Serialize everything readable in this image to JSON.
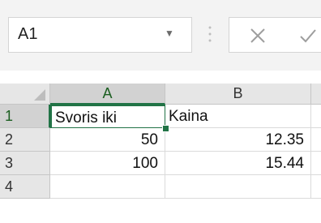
{
  "formula_bar": {
    "name_box": "A1",
    "fx_value": ""
  },
  "icons": {
    "name_box_dropdown": "chevron-down-icon",
    "separator": "vertical-dots-icon",
    "cancel": "close-icon",
    "enter": "checkmark-icon"
  },
  "columns": [
    "A",
    "B"
  ],
  "rows": [
    "1",
    "2",
    "3",
    "4"
  ],
  "cells": [
    [
      "Svoris iki",
      "Kaina"
    ],
    [
      "50",
      "12.35"
    ],
    [
      "100",
      "15.44"
    ],
    [
      "",
      ""
    ]
  ],
  "colors": {
    "accent": "#217346",
    "header_bg": "#e6e6e6",
    "header_selected_bg": "#d2d2d2"
  }
}
